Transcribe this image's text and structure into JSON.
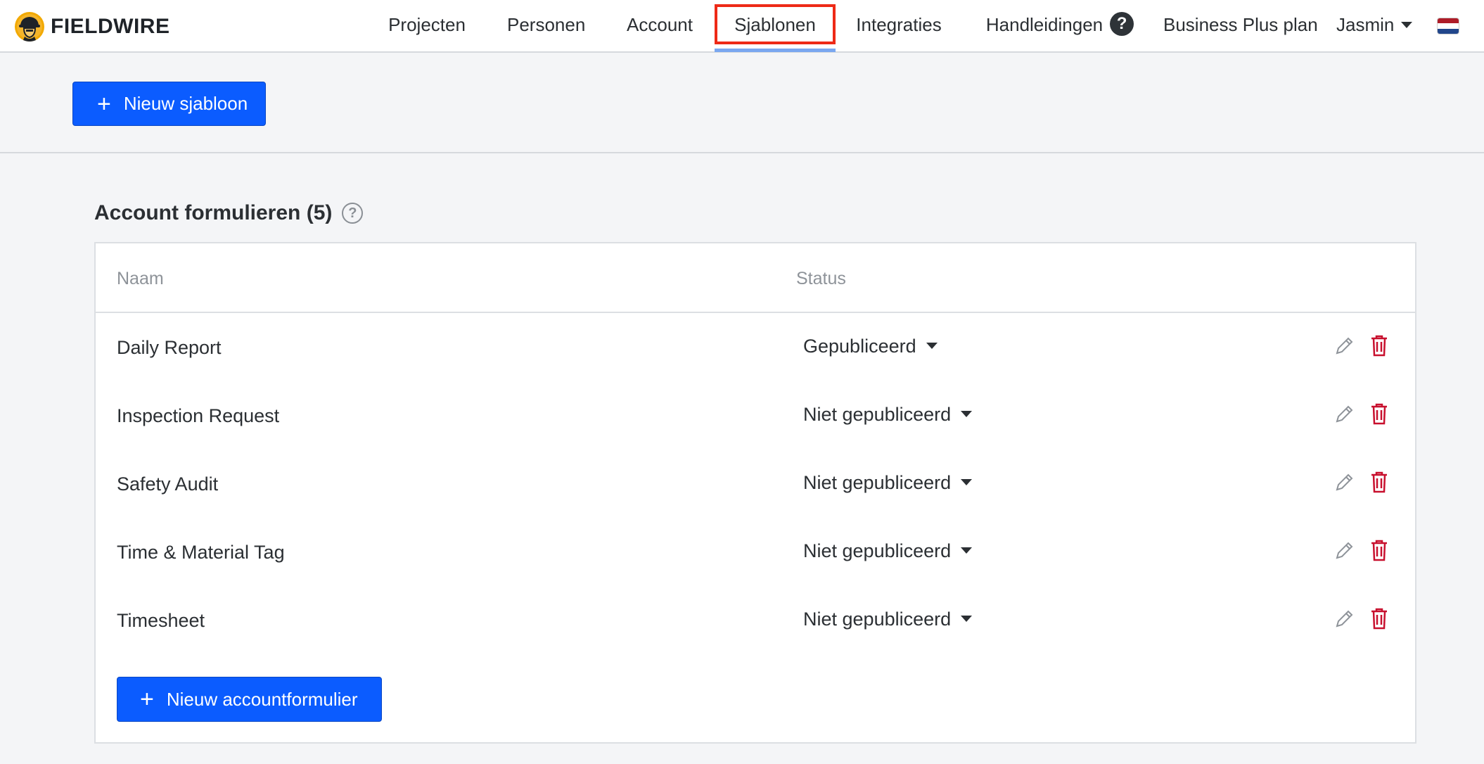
{
  "app": {
    "brand": "FIELDWIRE"
  },
  "nav": {
    "items": [
      {
        "label": "Projecten"
      },
      {
        "label": "Personen"
      },
      {
        "label": "Account"
      },
      {
        "label": "Sjablonen",
        "active": true
      },
      {
        "label": "Integraties"
      },
      {
        "label": "Handleidingen"
      }
    ],
    "help_badge": "?",
    "plan": "Business Plus plan",
    "user": "Jasmin",
    "language_flag": "netherlands-flag-icon"
  },
  "toolbar": {
    "new_template_label": "Nieuw sjabloon"
  },
  "section": {
    "title": "Account formulieren (5)",
    "help_icon": "?",
    "columns": {
      "name": "Naam",
      "status": "Status"
    },
    "rows": [
      {
        "name": "Daily Report",
        "status": "Gepubliceerd"
      },
      {
        "name": "Inspection Request",
        "status": "Niet gepubliceerd"
      },
      {
        "name": "Safety Audit",
        "status": "Niet gepubliceerd"
      },
      {
        "name": "Time & Material Tag",
        "status": "Niet gepubliceerd"
      },
      {
        "name": "Timesheet",
        "status": "Niet gepubliceerd"
      }
    ],
    "new_form_label": "Nieuw accountformulier"
  },
  "colors": {
    "primary": "#0b5cff",
    "delete": "#c8102e",
    "focus_outline": "#ee2a17",
    "active_underline": "#7aa7f0"
  }
}
